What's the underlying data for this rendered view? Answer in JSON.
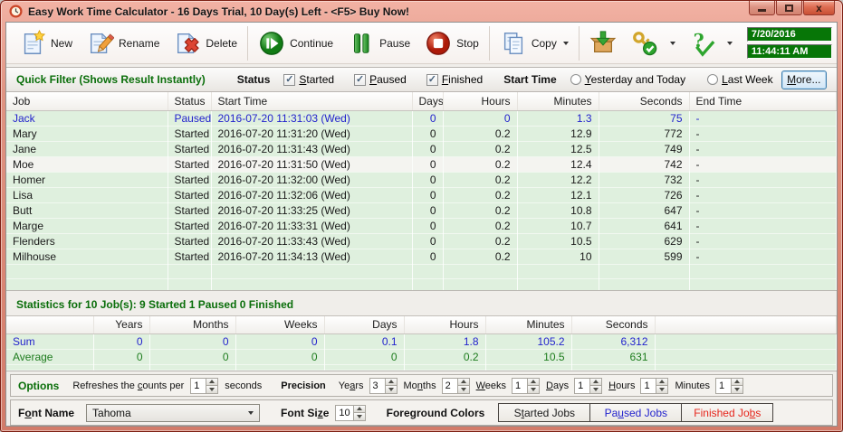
{
  "window": {
    "title": "Easy Work Time Calculator - 16 Days Trial, 10 Day(s) Left  - <F5> Buy Now!"
  },
  "toolbar": {
    "new_label": "New",
    "rename_label": "Rename",
    "delete_label": "Delete",
    "continue_label": "Continue",
    "pause_label": "Pause",
    "stop_label": "Stop",
    "copy_label": "Copy",
    "date": "7/20/2016",
    "time": "11:44:11 AM"
  },
  "filter": {
    "title": "Quick Filter (Shows Result Instantly)",
    "status_label": "Status",
    "status_options": [
      {
        "label": "Started",
        "u": 0,
        "checked": true
      },
      {
        "label": "Paused",
        "u": 0,
        "checked": true
      },
      {
        "label": "Finished",
        "u": 0,
        "checked": true
      }
    ],
    "start_time_label": "Start Time",
    "start_time_options": [
      {
        "label": "Yesterday and Today",
        "u": 0,
        "checked": false
      },
      {
        "label": "Last Week",
        "u": 0,
        "checked": false
      }
    ],
    "more": {
      "label": "More...",
      "u": 0
    }
  },
  "jobs_table": {
    "columns": [
      "Job",
      "Status",
      "Start Time",
      "Days",
      "Hours",
      "Minutes",
      "Seconds",
      "End Time"
    ],
    "rows": [
      {
        "job": "Jack",
        "status": "Paused",
        "start_time": "2016-07-20 11:31:03 (Wed)",
        "days": "0",
        "hours": "0",
        "minutes": "1.3",
        "seconds": "75",
        "end_time": "-",
        "color": "#2323cd"
      },
      {
        "job": "Mary",
        "status": "Started",
        "start_time": "2016-07-20 11:31:20 (Wed)",
        "days": "0",
        "hours": "0.2",
        "minutes": "12.9",
        "seconds": "772",
        "end_time": "-"
      },
      {
        "job": "Jane",
        "status": "Started",
        "start_time": "2016-07-20 11:31:43 (Wed)",
        "days": "0",
        "hours": "0.2",
        "minutes": "12.5",
        "seconds": "749",
        "end_time": "-"
      },
      {
        "job": "Moe",
        "status": "Started",
        "start_time": "2016-07-20 11:31:50 (Wed)",
        "days": "0",
        "hours": "0.2",
        "minutes": "12.4",
        "seconds": "742",
        "end_time": "-",
        "highlight": true
      },
      {
        "job": "Homer",
        "status": "Started",
        "start_time": "2016-07-20 11:32:00 (Wed)",
        "days": "0",
        "hours": "0.2",
        "minutes": "12.2",
        "seconds": "732",
        "end_time": "-"
      },
      {
        "job": "Lisa",
        "status": "Started",
        "start_time": "2016-07-20 11:32:06 (Wed)",
        "days": "0",
        "hours": "0.2",
        "minutes": "12.1",
        "seconds": "726",
        "end_time": "-"
      },
      {
        "job": "Butt",
        "status": "Started",
        "start_time": "2016-07-20 11:33:25 (Wed)",
        "days": "0",
        "hours": "0.2",
        "minutes": "10.8",
        "seconds": "647",
        "end_time": "-"
      },
      {
        "job": "Marge",
        "status": "Started",
        "start_time": "2016-07-20 11:33:31 (Wed)",
        "days": "0",
        "hours": "0.2",
        "minutes": "10.7",
        "seconds": "641",
        "end_time": "-"
      },
      {
        "job": "Flenders",
        "status": "Started",
        "start_time": "2016-07-20 11:33:43 (Wed)",
        "days": "0",
        "hours": "0.2",
        "minutes": "10.5",
        "seconds": "629",
        "end_time": "-"
      },
      {
        "job": "Milhouse",
        "status": "Started",
        "start_time": "2016-07-20 11:34:13 (Wed)",
        "days": "0",
        "hours": "0.2",
        "minutes": "10",
        "seconds": "599",
        "end_time": "-"
      }
    ]
  },
  "statistics": {
    "title": "Statistics for 10 Job(s): 9 Started 1 Paused 0 Finished",
    "columns": [
      "Years",
      "Months",
      "Weeks",
      "Days",
      "Hours",
      "Minutes",
      "Seconds"
    ],
    "rows": [
      {
        "label": "Sum",
        "values": [
          "0",
          "0",
          "0",
          "0.1",
          "1.8",
          "105.2",
          "6,312"
        ],
        "color": "#2323cd"
      },
      {
        "label": "Average",
        "values": [
          "0",
          "0",
          "0",
          "0",
          "0.2",
          "10.5",
          "631"
        ],
        "color": "#1d7c1d"
      }
    ]
  },
  "options": {
    "title": "Options",
    "refresh_label": {
      "label": "Refreshes the counts per",
      "u": 14
    },
    "refresh_value": "1",
    "refresh_suffix": "seconds",
    "precision_label": "Precision",
    "precision_fields": [
      {
        "label": "Years",
        "u": 2,
        "value": "3"
      },
      {
        "label": "Months",
        "u": 2,
        "value": "2"
      },
      {
        "label": "Weeks",
        "u": 0,
        "value": "1"
      },
      {
        "label": "Days",
        "u": 0,
        "value": "1"
      },
      {
        "label": "Hours",
        "u": 0,
        "value": "1"
      },
      {
        "label": "Minutes",
        "u": -1,
        "value": "1"
      }
    ]
  },
  "font_bar": {
    "font_name_label": {
      "label": "Font Name",
      "u": 1
    },
    "font_name_value": "Tahoma",
    "font_size_label": {
      "label": "Font Size",
      "u": 7
    },
    "font_size_value": "10",
    "foreground_label": "Foreground Colors",
    "color_buttons": [
      {
        "label": "Started Jobs",
        "u": 1,
        "color": "#1a1a1a"
      },
      {
        "label": "Paused Jobs",
        "u": 2,
        "color": "#2323cd"
      },
      {
        "label": "Finished Jobs",
        "u": 11,
        "color": "#e6251b"
      }
    ]
  },
  "colors": {
    "titlebar": "#e09482",
    "section_title_green": "#0a6e0a",
    "row_green": "#dff0de",
    "paused_blue": "#2323cd",
    "finished_red": "#e6251b",
    "average_green": "#1d7c1d",
    "datetime_bg": "#077607",
    "datetime_text": "#ffffff"
  }
}
